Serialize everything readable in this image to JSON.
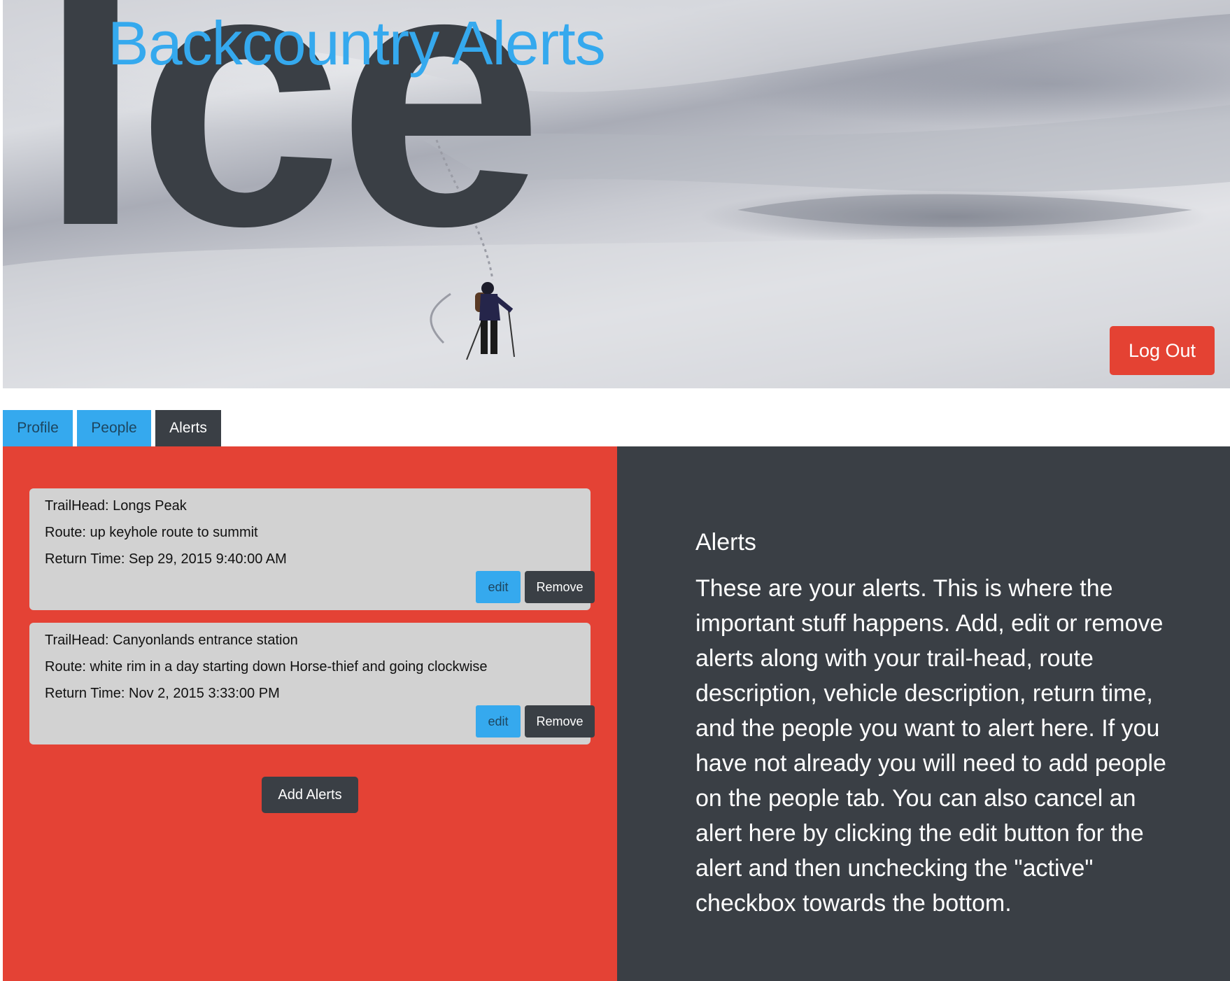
{
  "hero": {
    "logo_text": "Ice",
    "title": "Backcountry Alerts",
    "logout_label": "Log Out"
  },
  "tabs": [
    {
      "label": "Profile",
      "active": false
    },
    {
      "label": "People",
      "active": false
    },
    {
      "label": "Alerts",
      "active": true
    }
  ],
  "alerts": [
    {
      "trailhead": "TrailHead: Longs Peak",
      "route": "Route: up keyhole route to summit",
      "return_time": "Return Time: Sep 29, 2015 9:40:00 AM",
      "edit_label": "edit",
      "remove_label": "Remove"
    },
    {
      "trailhead": "TrailHead: Canyonlands entrance station",
      "route": "Route: white rim in a day starting down Horse-thief and going clockwise",
      "return_time": "Return Time: Nov 2, 2015 3:33:00 PM",
      "edit_label": "edit",
      "remove_label": "Remove"
    }
  ],
  "add_alerts_label": "Add Alerts",
  "info": {
    "heading": "Alerts",
    "body": "These are your alerts. This is where the important stuff happens. Add, edit or remove alerts along with your trail-head, route description, vehicle description, return time, and the people you want to alert here. If you have not already you will need to add people on the people tab. You can also cancel an alert here by clicking the edit button for the alert and then unchecking the \"active\" checkbox towards the bottom."
  },
  "colors": {
    "accent_blue": "#35a9ee",
    "alert_red": "#e44235",
    "dark_slate": "#3a3f45",
    "card_gray": "#d2d2d2"
  }
}
